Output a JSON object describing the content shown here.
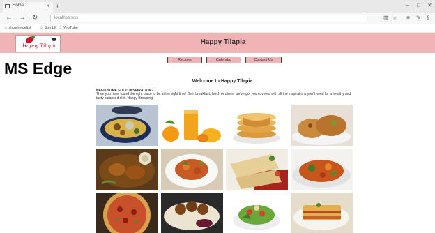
{
  "browser": {
    "tab_title": "Home",
    "tab_close": "×",
    "new_tab": "+",
    "address": "localhost:xxx",
    "icons": [
      "back-arrow-icon",
      "forward-arrow-icon",
      "refresh-icon",
      "reading-view-icon",
      "favorite-star-icon",
      "hub-icon",
      "notes-icon",
      "share-icon"
    ],
    "favorites": [
      "shoeheloelist",
      "Stenbfi",
      "YouTube"
    ]
  },
  "site": {
    "logo_text": "Happy Tilapia",
    "title": "Happy Tilapia",
    "nav": [
      "Recipes",
      "Calendar",
      "Contact Us"
    ]
  },
  "label": "MS Edge",
  "main": {
    "welcome": "Welcome to Happy Tilapia",
    "intro_question": "NEED SOME FOOD INSPIRATION?",
    "intro_text": "Then you have found the right place to be at the right time! Be it breakfast, lunch or dinner we've got you covered with all the inspirations you'll need for a healthy and tasty balanced diet. Happy Browsing!"
  },
  "food_images": [
    "fish-soup-bowl-image",
    "mango-juice-image",
    "pancakes-image",
    "stuffed-pastry-image",
    "braised-meat-image",
    "chicken-salad-image",
    "wrap-image",
    "stir-fry-image",
    "pizza-image",
    "meatballs-image",
    "green-salad-image",
    "lasagna-image"
  ],
  "colors": {
    "header_bg": "#f0b4b6",
    "logo_red": "#c0182c"
  }
}
